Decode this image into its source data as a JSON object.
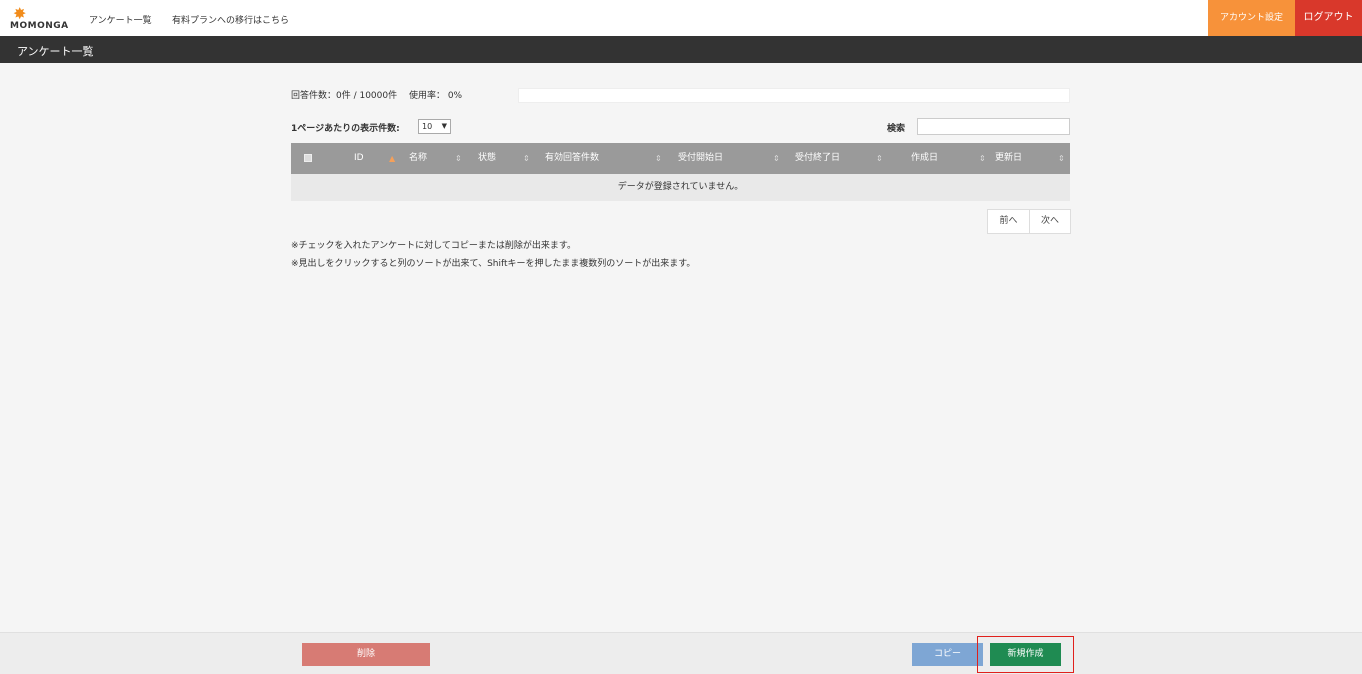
{
  "header": {
    "logo_text": "MOMONGA",
    "nav": [
      "アンケート一覧",
      "有料プランへの移行はこちら"
    ],
    "account_label": "アカウント設定",
    "logout_label": "ログアウト"
  },
  "page_title": "アンケート一覧",
  "usage": {
    "text": "回答件数：0件 / 10000件　 使用率： 0%",
    "percent": 0
  },
  "per_page": {
    "label": "1ページあたりの表示件数:",
    "value": "10"
  },
  "search": {
    "label": "検索",
    "value": ""
  },
  "table": {
    "columns": [
      "ID",
      "名称",
      "状態",
      "有効回答件数",
      "受付開始日",
      "受付終了日",
      "作成日",
      "更新日"
    ],
    "empty_message": "データが登録されていません。"
  },
  "pager": {
    "prev": "前へ",
    "next": "次へ"
  },
  "notes": [
    "※チェックを入れたアンケートに対してコピーまたは削除が出来ます。",
    "※見出しをクリックすると列のソートが出来て、Shiftキーを押したまま複数列のソートが出来ます。"
  ],
  "footer": {
    "delete": "削除",
    "copy": "コピー",
    "new": "新規作成"
  },
  "colors": {
    "accent_orange": "#f7923a",
    "logout_red": "#d9382b",
    "new_green": "#1f8b52"
  }
}
